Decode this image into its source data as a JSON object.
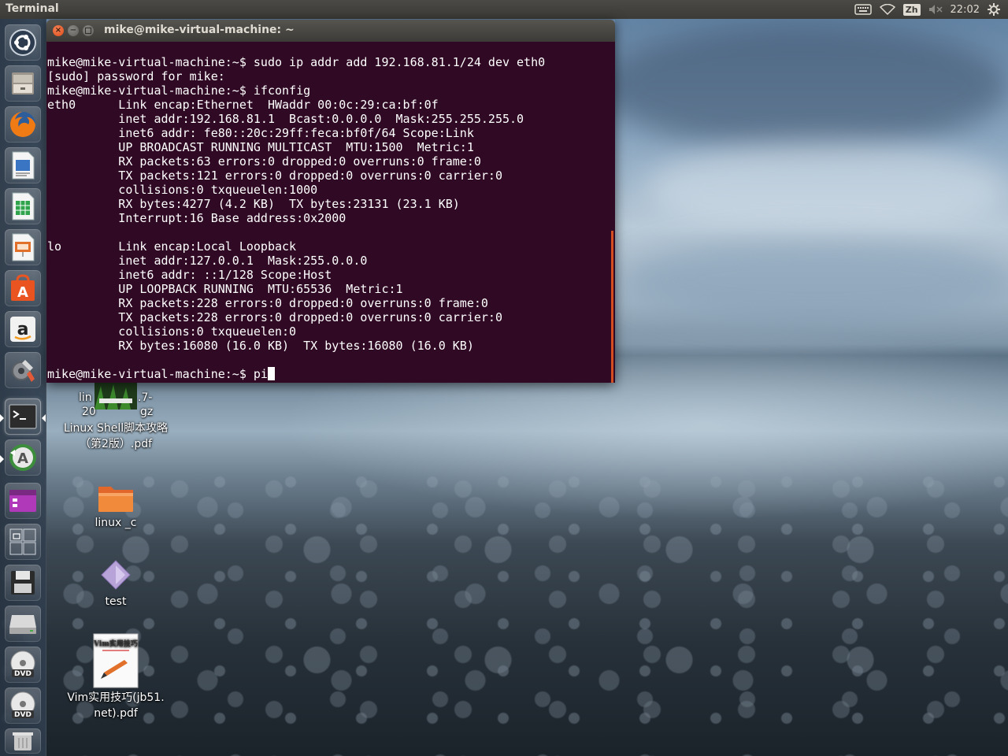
{
  "top_panel": {
    "app_title": "Terminal",
    "input_method": "Zh",
    "clock": "22:02"
  },
  "launcher": {
    "items": [
      {
        "name": "Dash",
        "icon": "ubuntu-logo-icon"
      },
      {
        "name": "Files",
        "icon": "file-cabinet-icon"
      },
      {
        "name": "Firefox",
        "icon": "firefox-icon"
      },
      {
        "name": "LibreOffice Writer",
        "icon": "writer-icon"
      },
      {
        "name": "LibreOffice Calc",
        "icon": "calc-icon"
      },
      {
        "name": "LibreOffice Impress",
        "icon": "impress-icon"
      },
      {
        "name": "Ubuntu Software Center",
        "icon": "software-center-icon"
      },
      {
        "name": "Amazon",
        "icon": "amazon-icon"
      },
      {
        "name": "System Settings",
        "icon": "settings-icon"
      },
      {
        "name": "Terminal",
        "icon": "terminal-icon"
      },
      {
        "name": "Software Updater",
        "icon": "updater-icon"
      },
      {
        "name": "Unity Tweak",
        "icon": "window-icon"
      },
      {
        "name": "Workspace Switcher",
        "icon": "workspaces-icon"
      },
      {
        "name": "Save",
        "icon": "floppy-icon"
      },
      {
        "name": "Drive",
        "icon": "drive-icon"
      },
      {
        "name": "DVD 1",
        "icon": "dvd-icon"
      },
      {
        "name": "DVD 2",
        "icon": "dvd-icon"
      },
      {
        "name": "Trash",
        "icon": "trash-icon"
      }
    ]
  },
  "desktop": {
    "icons": [
      {
        "label_line1": "Linux Shell脚本攻略",
        "label_line2": "（第2版）.pdf",
        "hidden_left": "lin",
        "hidden_left2": "20",
        "hidden_right": ".7-",
        "hidden_right2": "gz"
      },
      {
        "label_line1": "linux _c"
      },
      {
        "label_line1": "test"
      },
      {
        "label_line1": "Vim实用技巧(jb51.",
        "label_line2": "net).pdf"
      }
    ]
  },
  "terminal": {
    "title": "mike@mike-virtual-machine: ~",
    "lines": [
      "mike@mike-virtual-machine:~$ sudo ip addr add 192.168.81.1/24 dev eth0",
      "[sudo] password for mike:",
      "mike@mike-virtual-machine:~$ ifconfig",
      "eth0      Link encap:Ethernet  HWaddr 00:0c:29:ca:bf:0f",
      "          inet addr:192.168.81.1  Bcast:0.0.0.0  Mask:255.255.255.0",
      "          inet6 addr: fe80::20c:29ff:feca:bf0f/64 Scope:Link",
      "          UP BROADCAST RUNNING MULTICAST  MTU:1500  Metric:1",
      "          RX packets:63 errors:0 dropped:0 overruns:0 frame:0",
      "          TX packets:121 errors:0 dropped:0 overruns:0 carrier:0",
      "          collisions:0 txqueuelen:1000",
      "          RX bytes:4277 (4.2 KB)  TX bytes:23131 (23.1 KB)",
      "          Interrupt:16 Base address:0x2000",
      "",
      "lo        Link encap:Local Loopback",
      "          inet addr:127.0.0.1  Mask:255.0.0.0",
      "          inet6 addr: ::1/128 Scope:Host",
      "          UP LOOPBACK RUNNING  MTU:65536  Metric:1",
      "          RX packets:228 errors:0 dropped:0 overruns:0 frame:0",
      "          TX packets:228 errors:0 dropped:0 overruns:0 carrier:0",
      "          collisions:0 txqueuelen:0",
      "          RX bytes:16080 (16.0 KB)  TX bytes:16080 (16.0 KB)",
      ""
    ],
    "prompt": "mike@mike-virtual-machine:~$ ",
    "current_input": "pi"
  },
  "colors": {
    "terminal_bg": "#300a24",
    "accent": "#e95420",
    "panel_bg": "#3c3b37"
  }
}
